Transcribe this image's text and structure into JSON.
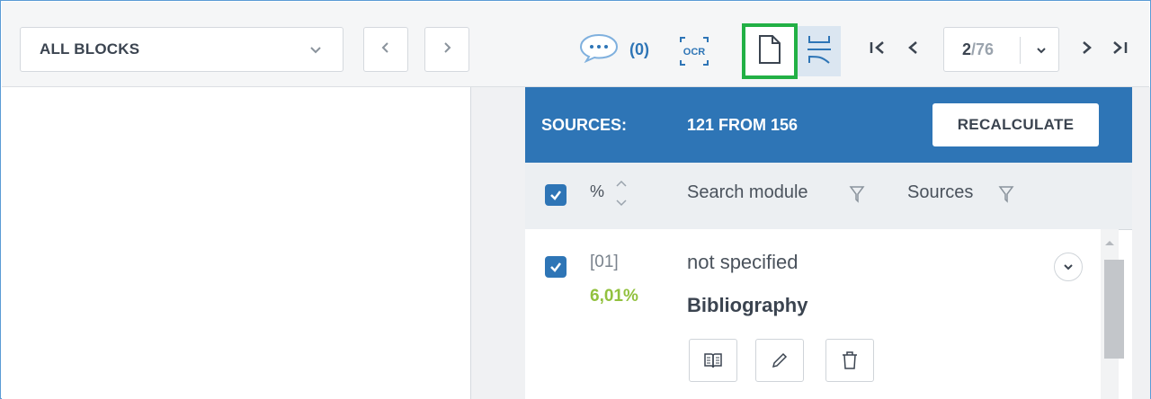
{
  "toolbar": {
    "block_filter": {
      "selected": "ALL BLOCKS"
    },
    "comments_count": "(0)",
    "ocr_label": "OCR",
    "page": {
      "current": "2",
      "total": "/76"
    }
  },
  "sources": {
    "label": "SOURCES:",
    "count_text": "121 FROM 156",
    "recalculate_label": "RECALCULATE"
  },
  "columns": {
    "percent": "%",
    "search_module": "Search module",
    "sources": "Sources"
  },
  "rows": [
    {
      "index": "[01]",
      "percent": "6,01%",
      "module": "not specified",
      "title": "Bibliography",
      "checked": true
    }
  ],
  "colors": {
    "accent": "#2e75b6",
    "highlight_border": "#22b045",
    "percent_green": "#92c13f",
    "active_toggle_bg": "#dbe6f1"
  },
  "icons": [
    "chevron-down-icon",
    "chevron-left-icon",
    "chevron-right-icon",
    "comment-icon",
    "ocr-icon",
    "document-icon",
    "split-view-icon",
    "first-page-icon",
    "prev-page-icon",
    "next-page-icon",
    "last-page-icon",
    "sort-icon",
    "filter-icon",
    "book-icon",
    "pencil-icon",
    "trash-icon"
  ]
}
